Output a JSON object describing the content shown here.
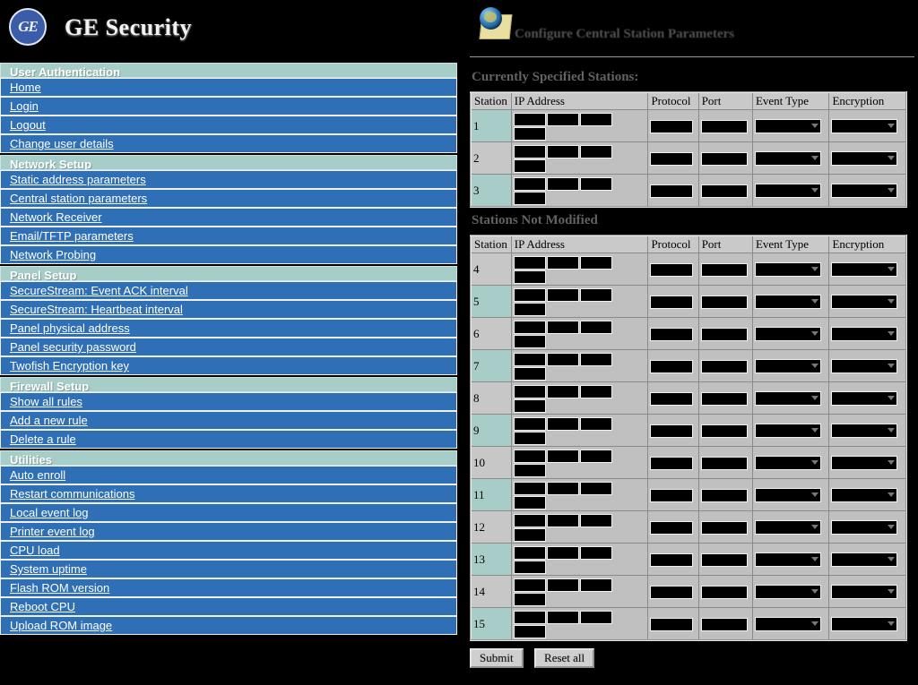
{
  "brand": {
    "logo_alt": "GE",
    "title": "GE Security"
  },
  "right_header": {
    "icon": "globe-page-icon",
    "title": "Configure Central Station Parameters"
  },
  "sidebar": {
    "sections": [
      {
        "heading": "User Authentication",
        "items": [
          "Home",
          "Login",
          "Logout",
          "Change user details"
        ]
      },
      {
        "heading": "Network Setup",
        "items": [
          "Static address parameters",
          "Central station parameters",
          "Network Receiver",
          "Email/TFTP parameters",
          "Network Probing"
        ]
      },
      {
        "heading": "Panel Setup",
        "items": [
          "SecureStream: Event ACK interval",
          "SecureStream: Heartbeat interval",
          "Panel physical address",
          "Panel security password",
          "Twofish Encryption key"
        ]
      },
      {
        "heading": "Firewall Setup",
        "items": [
          "Show all rules",
          "Add a new rule",
          "Delete a rule"
        ]
      },
      {
        "heading": "Utilities",
        "items": [
          "Auto enroll",
          "Restart communications",
          "Local event log",
          "Printer event log",
          "CPU load",
          "System uptime",
          "Flash ROM version",
          "Reboot CPU",
          "Upload ROM image"
        ]
      }
    ]
  },
  "main": {
    "table_one_title": "Currently Specified Stations:",
    "table_two_title": "Stations Not Modified",
    "columns": [
      "Station",
      "IP Address",
      "Protocol",
      "Port",
      "Event Type",
      "Encryption"
    ],
    "table_one_rows": [
      {
        "station": "1",
        "ip": [
          "",
          "",
          "",
          ""
        ],
        "protocol": "",
        "port": "",
        "event_type": "",
        "encryption": ""
      },
      {
        "station": "2",
        "ip": [
          "",
          "",
          "",
          ""
        ],
        "protocol": "",
        "port": "",
        "event_type": "",
        "encryption": ""
      },
      {
        "station": "3",
        "ip": [
          "",
          "",
          "",
          ""
        ],
        "protocol": "",
        "port": "",
        "event_type": "",
        "encryption": ""
      }
    ],
    "table_two_rows": [
      {
        "station": "4",
        "ip": [
          "",
          "",
          "",
          ""
        ],
        "protocol": "",
        "port": "",
        "event_type": "",
        "encryption": ""
      },
      {
        "station": "5",
        "ip": [
          "",
          "",
          "",
          ""
        ],
        "protocol": "",
        "port": "",
        "event_type": "",
        "encryption": ""
      },
      {
        "station": "6",
        "ip": [
          "",
          "",
          "",
          ""
        ],
        "protocol": "",
        "port": "",
        "event_type": "",
        "encryption": ""
      },
      {
        "station": "7",
        "ip": [
          "",
          "",
          "",
          ""
        ],
        "protocol": "",
        "port": "",
        "event_type": "",
        "encryption": ""
      },
      {
        "station": "8",
        "ip": [
          "",
          "",
          "",
          ""
        ],
        "protocol": "",
        "port": "",
        "event_type": "",
        "encryption": ""
      },
      {
        "station": "9",
        "ip": [
          "",
          "",
          "",
          ""
        ],
        "protocol": "",
        "port": "",
        "event_type": "",
        "encryption": ""
      },
      {
        "station": "10",
        "ip": [
          "",
          "",
          "",
          ""
        ],
        "protocol": "",
        "port": "",
        "event_type": "",
        "encryption": ""
      },
      {
        "station": "11",
        "ip": [
          "",
          "",
          "",
          ""
        ],
        "protocol": "",
        "port": "",
        "event_type": "",
        "encryption": ""
      },
      {
        "station": "12",
        "ip": [
          "",
          "",
          "",
          ""
        ],
        "protocol": "",
        "port": "",
        "event_type": "",
        "encryption": ""
      },
      {
        "station": "13",
        "ip": [
          "",
          "",
          "",
          ""
        ],
        "protocol": "",
        "port": "",
        "event_type": "",
        "encryption": ""
      },
      {
        "station": "14",
        "ip": [
          "",
          "",
          "",
          ""
        ],
        "protocol": "",
        "port": "",
        "event_type": "",
        "encryption": ""
      },
      {
        "station": "15",
        "ip": [
          "",
          "",
          "",
          ""
        ],
        "protocol": "",
        "port": "",
        "event_type": "",
        "encryption": ""
      }
    ],
    "submit_label": "Submit",
    "reset_label": "Reset all"
  },
  "colors": {
    "background": "#000000",
    "nav_item": "#2f6fb5",
    "nav_heading": "#a7cdc9",
    "table_header": "#c9c9c9",
    "row_odd": "#a8cdc9",
    "row_even": "#c7c7c7",
    "field": "#000000"
  }
}
